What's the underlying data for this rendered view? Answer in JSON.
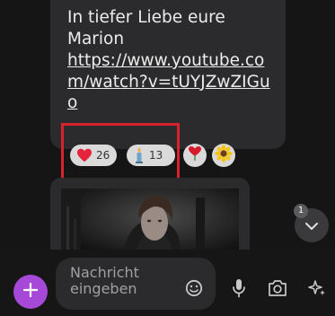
{
  "message": {
    "text": "In tiefer Liebe eure\nMarion",
    "link": "https://www.youtube.com/watch?v=tUYJZwZIGuo"
  },
  "reactions": [
    {
      "icon": "heart-icon",
      "count": "26"
    },
    {
      "icon": "candle-icon",
      "count": "13"
    }
  ],
  "extra_reactions": [
    {
      "icon": "red-heart-flower-icon"
    },
    {
      "icon": "sunflower-icon"
    }
  ],
  "scroll_down": {
    "badge": "1"
  },
  "composer": {
    "placeholder": "Nachricht eingeben"
  },
  "colors": {
    "accent": "#a649d9",
    "highlight": "#d8222c",
    "heart": "#e5243b"
  }
}
